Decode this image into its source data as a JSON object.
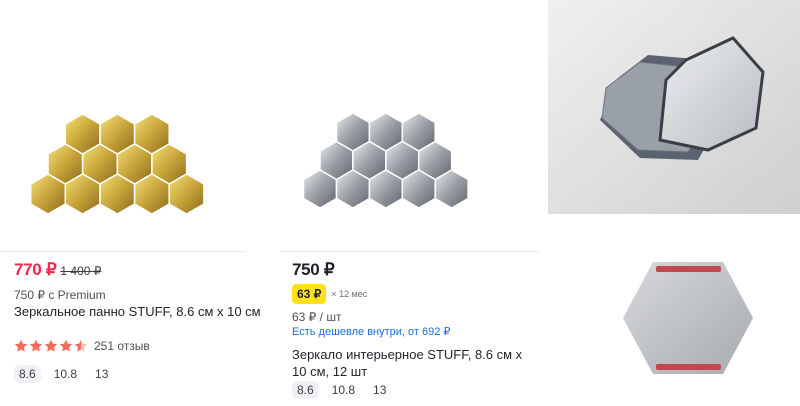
{
  "products": [
    {
      "price": "770 ₽",
      "old_price": "1 400 ₽",
      "premium_text": "750 ₽ с Premium",
      "title": "Зеркальное панно STUFF, 8.6 см х 10 см",
      "rating_stars": 4.5,
      "reviews": "251 отзыв",
      "sizes": [
        "8.6",
        "10.8",
        "13"
      ],
      "selected_size": "8.6",
      "image_icon": "gold-hexagon-mirror-icon"
    },
    {
      "price": "750 ₽",
      "installment_price": "63 ₽",
      "installment_term": "× 12 мес",
      "unit_price": "63 ₽ / шт",
      "cheaper_link": "Есть дешевле внутри, от 692 ₽",
      "title": "Зеркало интерьерное STUFF, 8.6 см х 10 см, 12 шт",
      "sizes": [
        "8.6",
        "10.8",
        "13"
      ],
      "selected_size": "8.6",
      "image_icon": "silver-hexagon-mirror-icon"
    }
  ],
  "colors": {
    "sale_red": "#f5254b",
    "installment_yellow": "#ffe11a",
    "link_blue": "#1c6ed9",
    "star_orange": "#f26b5b"
  },
  "photos": [
    {
      "icon": "stacked-hexagon-mirrors-photo"
    },
    {
      "icon": "hexagon-mirror-back-tape-photo"
    }
  ]
}
